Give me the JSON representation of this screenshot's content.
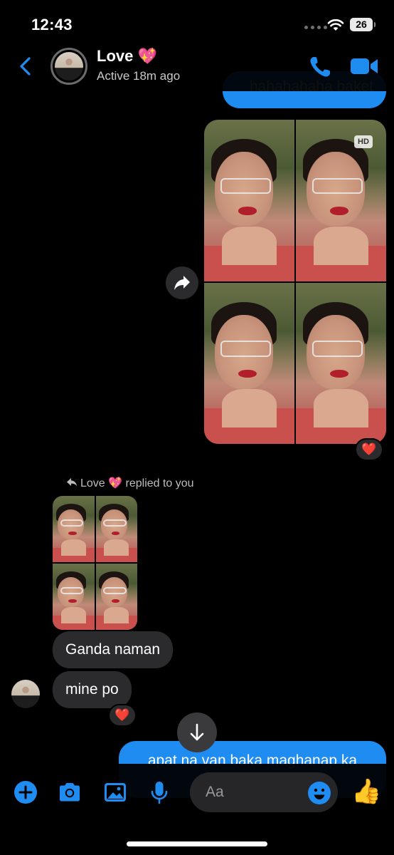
{
  "status_bar": {
    "time": "12:43",
    "battery": "26"
  },
  "header": {
    "contact_name": "Love 💖",
    "status": "Active 18m ago",
    "icons": [
      "back-chevron-icon",
      "phone-icon",
      "video-camera-icon"
    ]
  },
  "conversation": {
    "outgoing_top_text": "hahahahaha baket",
    "hd_badge": "HD",
    "reaction_top": "❤️",
    "reply_label": "Love 💖  replied to you",
    "incoming_messages": [
      "Ganda naman",
      "mine po"
    ],
    "reaction_bottom": "❤️",
    "outgoing_bottom_text": "apat na van baka maghanap ka"
  },
  "composer": {
    "placeholder": "Aa",
    "icons": [
      "add-icon",
      "camera-icon",
      "image-icon",
      "microphone-icon",
      "emoji-icon",
      "thumbs-up-icon"
    ],
    "like": "👍"
  },
  "colors": {
    "accent": "#1f8cf2",
    "incoming_bubble": "#2b2b2d",
    "background": "#000000"
  }
}
